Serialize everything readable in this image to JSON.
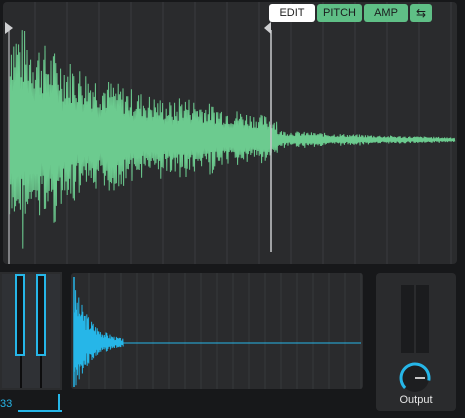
{
  "toolbar": {
    "edit_label": "EDIT",
    "pitch_label": "PITCH",
    "amp_label": "AMP",
    "swap_icon": "swap-arrows-icon",
    "active_tab": "EDIT"
  },
  "keyboard": {
    "note_number": "33"
  },
  "output": {
    "label": "Output"
  },
  "colors": {
    "waveform": "#6ccb8f",
    "accent_blue": "#26b6e8",
    "button_green": "#5fbf86",
    "panel": "#2a2b2d",
    "background": "#17181a"
  }
}
